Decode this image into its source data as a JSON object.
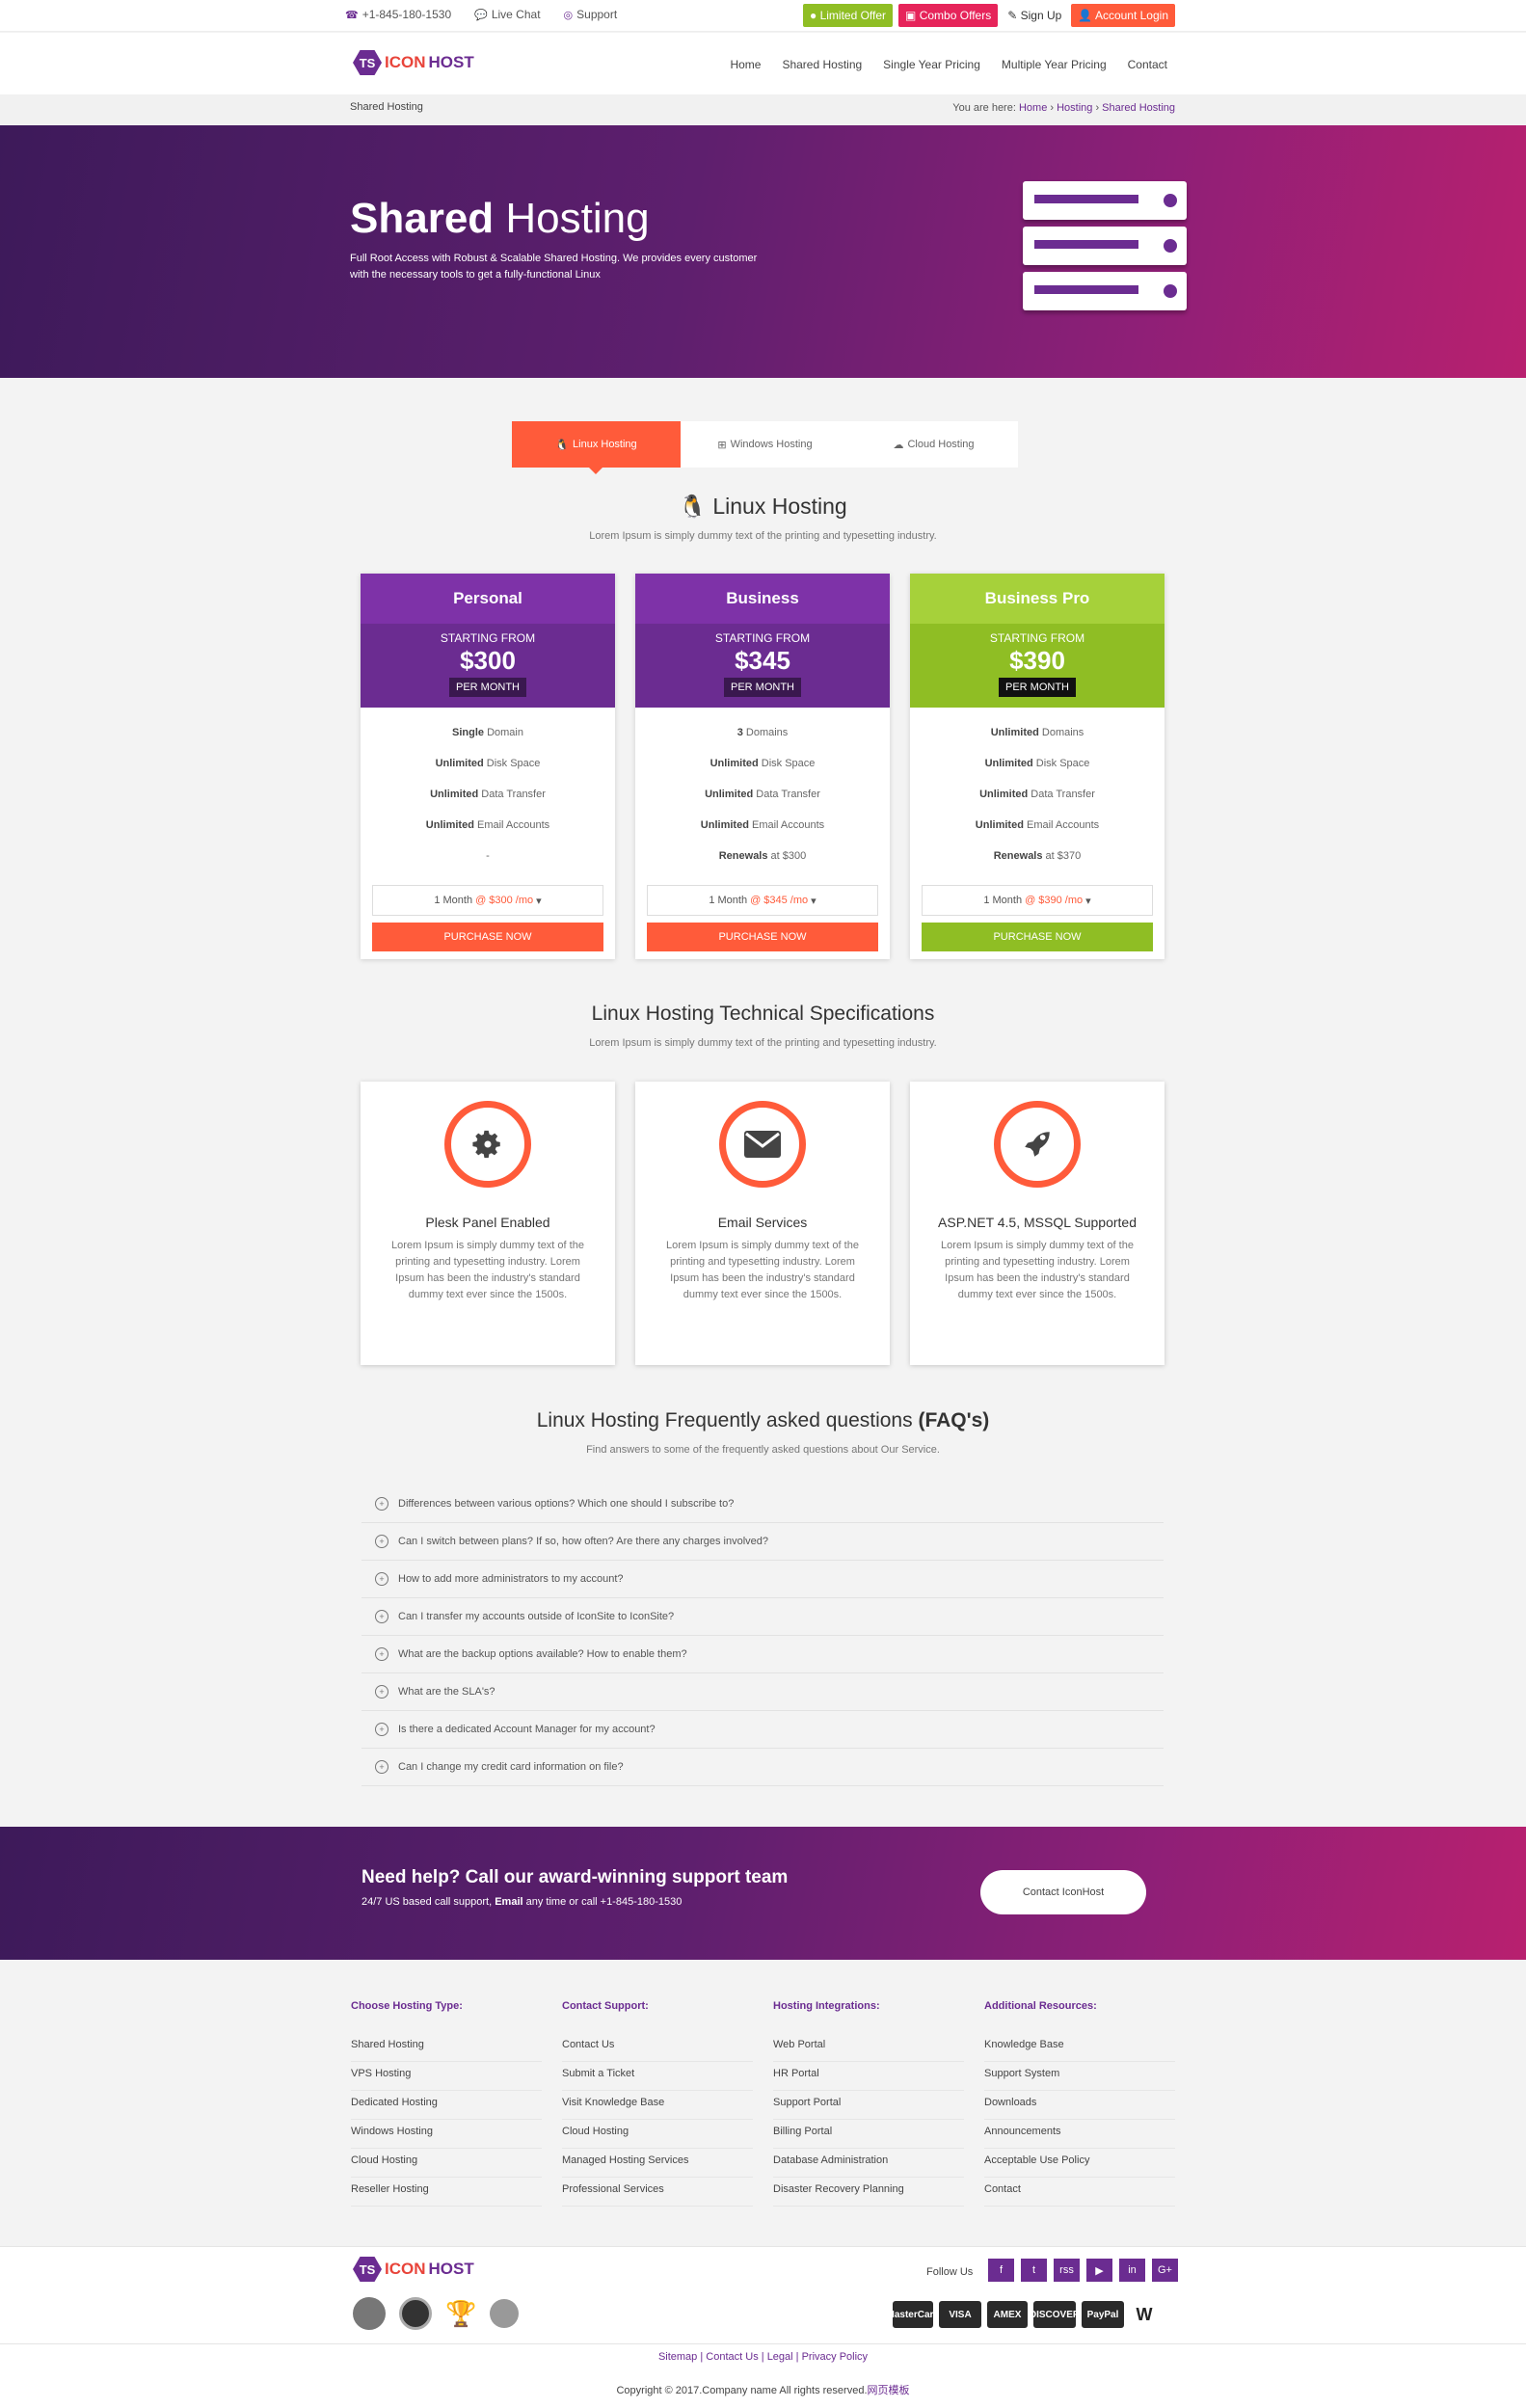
{
  "colors": {
    "purple": "#6b2c91",
    "orange": "#ff5b3a",
    "green": "#8fbe24",
    "pink": "#e6245a"
  },
  "topbar": {
    "phone": "+1-845-180-1530",
    "live_chat": "Live Chat",
    "support": "Support",
    "limited_offer": "Limited Offer",
    "combo_offers": "Combo Offers",
    "sign_up": "Sign Up",
    "account_login": "Account Login"
  },
  "logo": {
    "badge": "TS",
    "part1": "ICON",
    "part2": "HOST"
  },
  "nav": [
    "Home",
    "Shared Hosting",
    "Single Year Pricing",
    "Multiple Year Pricing",
    "Contact"
  ],
  "breadcrumb": {
    "page": "Shared Hosting",
    "prefix": "You are here:",
    "items": [
      "Home",
      "Hosting",
      "Shared Hosting"
    ]
  },
  "hero": {
    "title_bold": "Shared",
    "title_rest": " Hosting",
    "text": "Full Root Access with Robust & Scalable Shared Hosting. We provides every customer with the necessary tools to get a fully-functional Linux"
  },
  "tabs": [
    {
      "label": "Linux Hosting",
      "icon": "linux-icon"
    },
    {
      "label": "Windows Hosting",
      "icon": "windows-icon"
    },
    {
      "label": "Cloud Hosting",
      "icon": "cloud-icon"
    }
  ],
  "linux": {
    "title": "Linux Hosting",
    "subtitle": "Lorem Ipsum is simply dummy text of the printing and typesetting industry."
  },
  "plans": [
    {
      "name": "Personal",
      "starting": "STARTING FROM",
      "price": "$300",
      "per": "PER MONTH",
      "features": [
        [
          "Single",
          " Domain"
        ],
        [
          "Unlimited",
          " Disk Space"
        ],
        [
          "Unlimited",
          " Data Transfer"
        ],
        [
          "Unlimited",
          " Email Accounts"
        ],
        [
          "",
          "-"
        ]
      ],
      "select_prefix": "1 Month",
      "select_price": "@ $300 /mo",
      "button": "PURCHASE NOW"
    },
    {
      "name": "Business",
      "starting": "STARTING FROM",
      "price": "$345",
      "per": "PER MONTH",
      "features": [
        [
          "3",
          " Domains"
        ],
        [
          "Unlimited",
          " Disk Space"
        ],
        [
          "Unlimited",
          " Data Transfer"
        ],
        [
          "Unlimited",
          " Email Accounts"
        ],
        [
          "Renewals",
          " at $300"
        ]
      ],
      "select_prefix": "1 Month",
      "select_price": "@ $345 /mo",
      "button": "PURCHASE NOW"
    },
    {
      "name": "Business Pro",
      "starting": "STARTING FROM",
      "price": "$390",
      "per": "PER MONTH",
      "features": [
        [
          "Unlimited",
          " Domains"
        ],
        [
          "Unlimited",
          " Disk Space"
        ],
        [
          "Unlimited",
          " Data Transfer"
        ],
        [
          "Unlimited",
          " Email Accounts"
        ],
        [
          "Renewals",
          " at $370"
        ]
      ],
      "select_prefix": "1 Month",
      "select_price": "@ $390 /mo",
      "button": "PURCHASE NOW"
    }
  ],
  "specs": {
    "title": "Linux Hosting Technical Specifications",
    "subtitle": "Lorem Ipsum is simply dummy text of the printing and typesetting industry.",
    "items": [
      {
        "title": "Plesk Panel Enabled",
        "icon": "gear-icon",
        "text": "Lorem Ipsum is simply dummy text of the printing and typesetting industry. Lorem Ipsum has been the industry's standard dummy text ever since the 1500s."
      },
      {
        "title": "Email Services",
        "icon": "envelope-icon",
        "text": "Lorem Ipsum is simply dummy text of the printing and typesetting industry. Lorem Ipsum has been the industry's standard dummy text ever since the 1500s."
      },
      {
        "title": "ASP.NET 4.5, MSSQL Supported",
        "icon": "rocket-icon",
        "text": "Lorem Ipsum is simply dummy text of the printing and typesetting industry. Lorem Ipsum has been the industry's standard dummy text ever since the 1500s."
      }
    ]
  },
  "faq": {
    "title": "Linux Hosting Frequently asked questions ",
    "title_bold": "(FAQ's)",
    "subtitle": "Find answers to some of the frequently asked questions about Our Service.",
    "items": [
      "Differences between various options? Which one should I subscribe to?",
      "Can I switch between plans? If so, how often? Are there any charges involved?",
      "How to add more administrators to my account?",
      "Can I transfer my accounts outside of IconSite to IconSite?",
      "What are the backup options available? How to enable them?",
      "What are the SLA's?",
      "Is there a dedicated Account Manager for my account?",
      "Can I change my credit card information on file?"
    ]
  },
  "help": {
    "title": "Need help? Call our award-winning support team",
    "text_pre": "24/7 US based call support, ",
    "text_bold": "Email",
    "text_post": " any time or call +1-845-180-1530",
    "button": "Contact IconHost"
  },
  "footer": {
    "columns": [
      {
        "title": "Choose Hosting Type:",
        "links": [
          "Shared Hosting",
          "VPS Hosting",
          "Dedicated Hosting",
          "Windows Hosting",
          "Cloud Hosting",
          "Reseller Hosting"
        ]
      },
      {
        "title": "Contact Support:",
        "links": [
          "Contact Us",
          "Submit a Ticket",
          "Visit Knowledge Base",
          "Cloud Hosting",
          "Managed Hosting Services",
          "Professional Services"
        ]
      },
      {
        "title": "Hosting Integrations:",
        "links": [
          "Web Portal",
          "HR Portal",
          "Support Portal",
          "Billing Portal",
          "Database Administration",
          "Disaster Recovery Planning"
        ]
      },
      {
        "title": "Additional Resources:",
        "links": [
          "Knowledge Base",
          "Support System",
          "Downloads",
          "Announcements",
          "Acceptable Use Policy",
          "Contact"
        ]
      }
    ],
    "follow": "Follow Us",
    "social": [
      "f",
      "t",
      "rss",
      "▶",
      "in",
      "G+"
    ],
    "cards": [
      "MasterCard",
      "VISA",
      "AMEX",
      "DISCOVER",
      "PayPal",
      "W"
    ],
    "links": [
      "Sitemap",
      "Contact Us",
      "Legal",
      "Privacy Policy"
    ],
    "copyright": "Copyright © 2017.Company name All rights reserved.",
    "copyright_link": "网页模板"
  }
}
